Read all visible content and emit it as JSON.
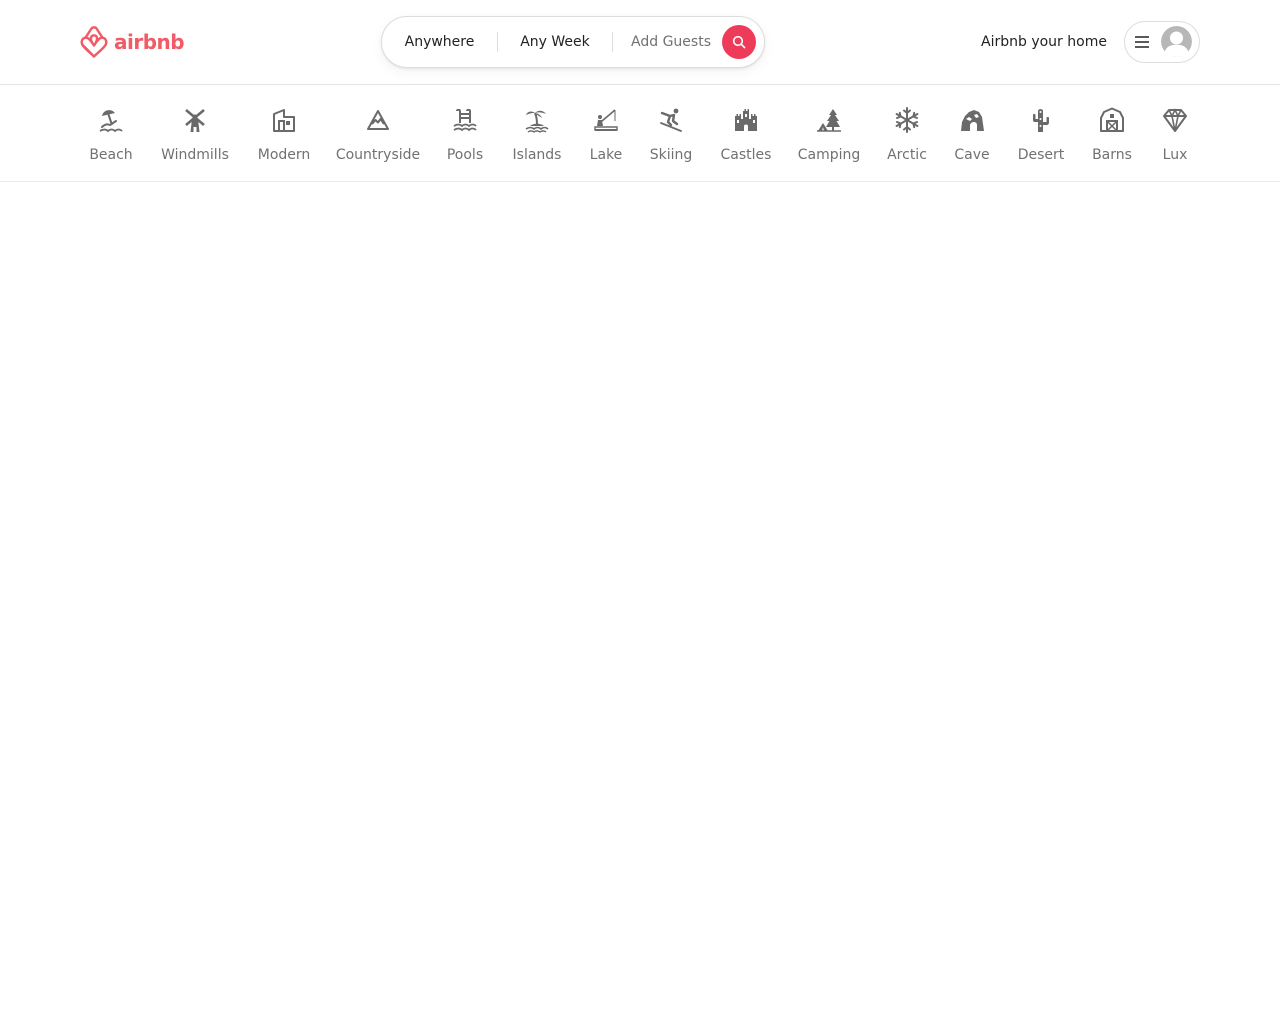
{
  "brand": {
    "name": "airbnb",
    "color": "#f15b67"
  },
  "search": {
    "location_label": "Anywhere",
    "dates_label": "Any Week",
    "guests_label": "Add Guests",
    "button_color": "#ef3b5a",
    "button_icon": "search-icon"
  },
  "host_link": "Airbnb your home",
  "user_menu": {
    "menu_icon": "hamburger-icon",
    "avatar_icon": "user-avatar-icon"
  },
  "categories": [
    {
      "label": "Beach",
      "icon": "beach-umbrella-icon"
    },
    {
      "label": "Windmills",
      "icon": "windmill-icon"
    },
    {
      "label": "Modern",
      "icon": "modern-building-icon"
    },
    {
      "label": "Countryside",
      "icon": "mountain-icon"
    },
    {
      "label": "Pools",
      "icon": "pool-ladder-icon"
    },
    {
      "label": "Islands",
      "icon": "palm-island-icon"
    },
    {
      "label": "Lake",
      "icon": "fishing-icon"
    },
    {
      "label": "Skiing",
      "icon": "skier-icon"
    },
    {
      "label": "Castles",
      "icon": "castle-icon"
    },
    {
      "label": "Camping",
      "icon": "tent-tree-icon"
    },
    {
      "label": "Arctic",
      "icon": "snowflake-icon"
    },
    {
      "label": "Cave",
      "icon": "cave-icon"
    },
    {
      "label": "Desert",
      "icon": "cactus-icon"
    },
    {
      "label": "Barns",
      "icon": "barn-icon"
    },
    {
      "label": "Lux",
      "icon": "diamond-icon"
    }
  ]
}
